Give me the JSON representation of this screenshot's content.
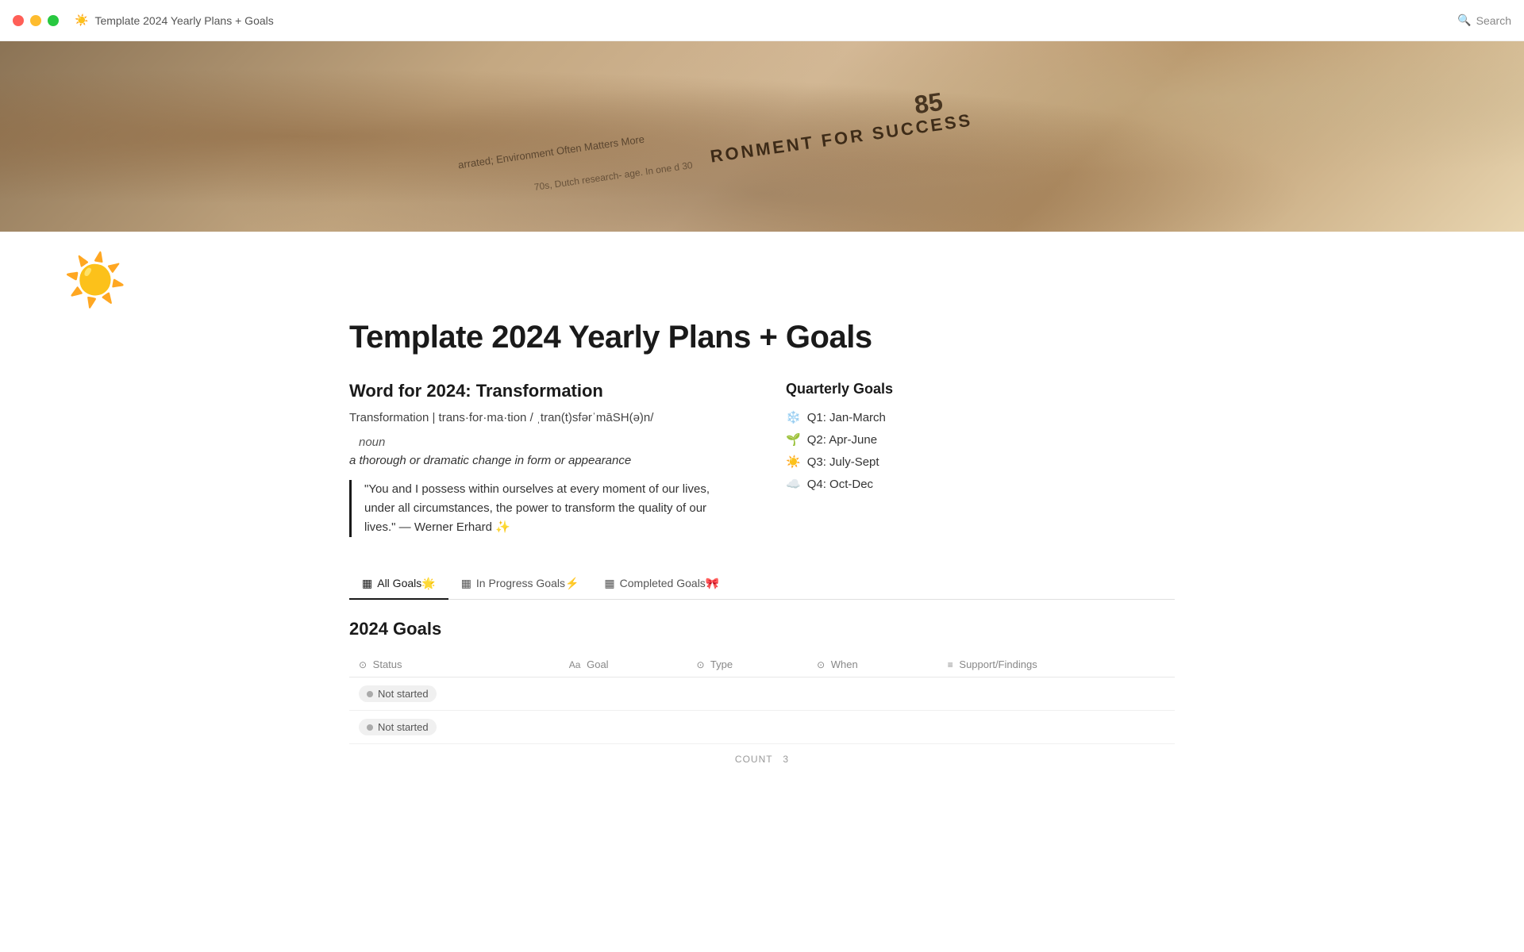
{
  "titlebar": {
    "page_name": "Template 2024 Yearly Plans + Goals",
    "search_label": "Search"
  },
  "hero": {
    "book_text": "RONMENT FOR SUCCESS",
    "sub_text": "arrated; Environment Often Matters More",
    "sub_text2": "70s, Dutch research-  age. In one  d 30",
    "number": "85"
  },
  "page": {
    "icon": "☀️",
    "title": "Template 2024 Yearly Plans + Goals"
  },
  "word_section": {
    "heading": "Word for 2024: Transformation",
    "definition": "Transformation | trans·for·ma·tion / ˌtran(t)sfərˈmāSH(ə)n/",
    "part_of_speech": "noun",
    "meaning": "a thorough or dramatic change in form or appearance",
    "quote": "\"You and I possess within ourselves at every moment of our lives, under all circumstances, the power to transform the quality of our lives.\" — Werner Erhard ✨"
  },
  "quarterly_goals": {
    "heading": "Quarterly Goals",
    "items": [
      {
        "emoji": "❄️",
        "label": "Q1: Jan-March"
      },
      {
        "emoji": "🌱",
        "label": "Q2: Apr-June"
      },
      {
        "emoji": "☀️",
        "label": "Q3: July-Sept"
      },
      {
        "emoji": "☁️",
        "label": "Q4: Oct-Dec"
      }
    ]
  },
  "tabs": [
    {
      "id": "all",
      "icon": "▦",
      "label": "All Goals",
      "emoji": "🌟",
      "active": true
    },
    {
      "id": "in-progress",
      "icon": "▦",
      "label": "In Progress Goals",
      "emoji": "⚡",
      "active": false
    },
    {
      "id": "completed",
      "icon": "▦",
      "label": "Completed Goals",
      "emoji": "🎀",
      "active": false
    }
  ],
  "goals_table": {
    "section_title": "2024 Goals",
    "columns": [
      {
        "icon": "⊙",
        "label": "Status"
      },
      {
        "icon": "Aa",
        "label": "Goal"
      },
      {
        "icon": "⊙",
        "label": "Type"
      },
      {
        "icon": "⊙",
        "label": "When"
      },
      {
        "icon": "≡",
        "label": "Support/Findings"
      }
    ],
    "rows": [
      {
        "status": "Not started"
      },
      {
        "status": "Not started"
      }
    ],
    "count_label": "COUNT",
    "count_value": "3"
  }
}
